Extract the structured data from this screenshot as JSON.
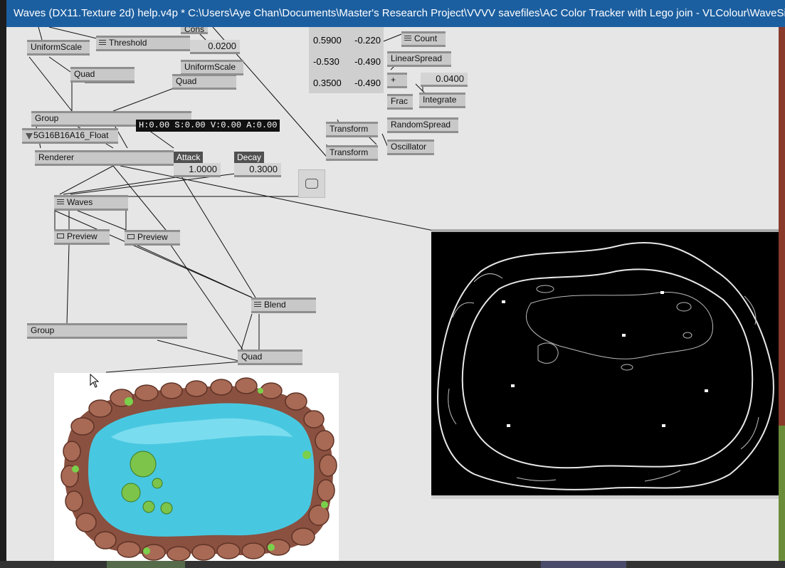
{
  "window": {
    "title": "Waves (DX11.Texture 2d) help.v4p *  C:\\Users\\Aye Chan\\Documents\\Master's Research Project\\VVVV savefiles\\AC Color Tracker with Lego join - VLColour\\WaveSi..."
  },
  "nodes": {
    "cons": "Cons",
    "uniformscale_1": "UniformScale",
    "threshold": "Threshold",
    "threshold_value": "0.0200",
    "uniformscale_2": "UniformScale",
    "quad_1": "Quad",
    "quad_2": "Quad",
    "group_1": "Group",
    "hsva": "H:0.00  S:0.00  V:0.00  A:0.00",
    "format": "5G16B16A16_Float",
    "renderer": "Renderer",
    "attack_label": "Attack",
    "attack_value": "1.0000",
    "decay_label": "Decay",
    "decay_value": "0.3000",
    "waves": "Waves",
    "preview_1": "Preview",
    "preview_2": "Preview",
    "blend": "Blend",
    "group_2": "Group",
    "quad_3": "Quad",
    "count": "Count",
    "linearspread": "LinearSpread",
    "plus": "+",
    "plus_value": "0.0400",
    "frac": "Frac",
    "integrate": "Integrate",
    "randomspread": "RandomSpread",
    "oscillator": "Oscillator",
    "transform_1": "Transform",
    "transform_2": "Transform"
  },
  "spread_values": [
    [
      "0.5900",
      "-0.220"
    ],
    [
      "-0.530",
      "-0.490"
    ],
    [
      "0.3500",
      "-0.490"
    ]
  ],
  "colors": {
    "titlebar": "#1c5fa0",
    "patch_bg": "#e6e6e6",
    "node": "#c8c8c8",
    "wire": "#111111",
    "water": "#48c8e0",
    "rock": "#8a5040"
  }
}
